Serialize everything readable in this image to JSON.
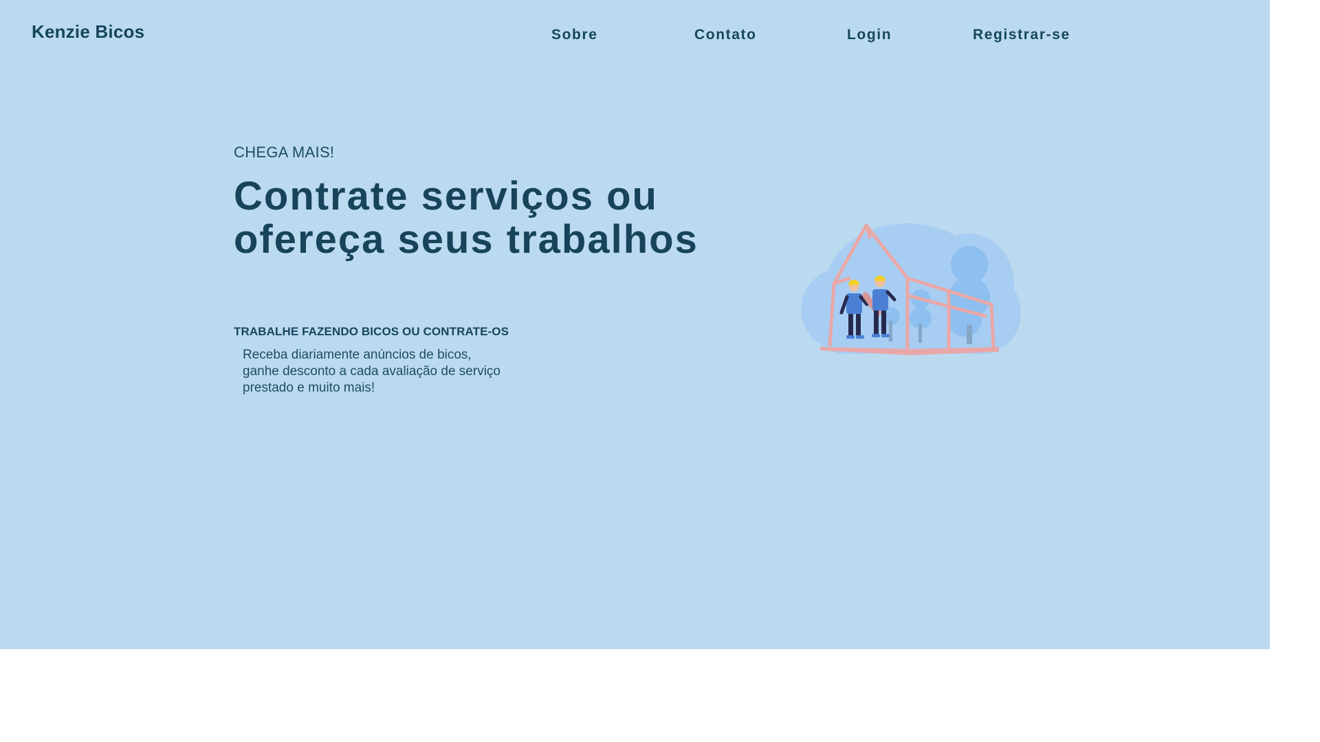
{
  "header": {
    "logo": "Kenzie Bicos",
    "nav": [
      {
        "label": "Sobre"
      },
      {
        "label": "Contato"
      },
      {
        "label": "Login"
      },
      {
        "label": "Registrar-se"
      }
    ]
  },
  "hero": {
    "eyebrow": "CHEGA MAIS!",
    "headline": "Contrate serviços ou ofereça seus trabalhos",
    "subheadline": "TRABALHE FAZENDO BICOS OU CONTRATE-OS",
    "description": "Receba diariamente anúncios de bicos, ganhe desconto a cada avaliação de serviço prestado e muito mais!",
    "illustration": "workers-building-house-illustration"
  },
  "colors": {
    "hero_background": "#bbdaf0",
    "text_dark": "#15465c",
    "house_frame": "#e9a8a8",
    "worker_shirt": "#4a7fd4"
  }
}
